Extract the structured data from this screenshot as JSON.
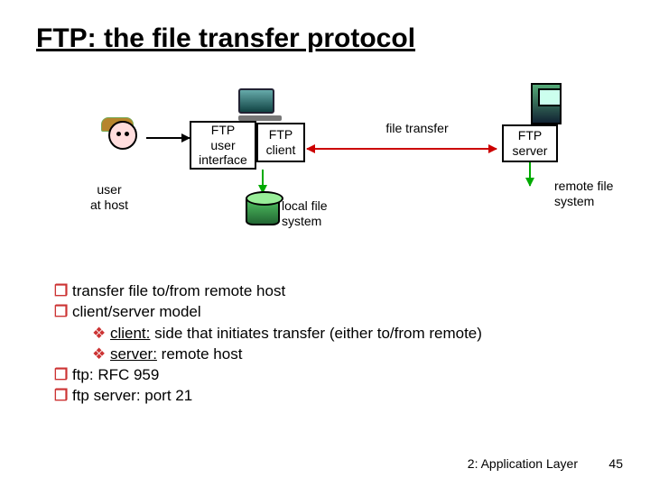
{
  "title": "FTP: the file transfer protocol",
  "diagram": {
    "user_at_host": "user\nat host",
    "ftp_ui": "FTP\nuser\ninterface",
    "ftp_client": "FTP\nclient",
    "ftp_server": "FTP\nserver",
    "file_transfer": "file transfer",
    "local_fs": "local file\nsystem",
    "remote_fs": "remote file\nsystem"
  },
  "bullets": {
    "b1": "transfer file to/from remote host",
    "b2": "client/server model",
    "b2a_prefix": "client:",
    "b2a_rest": " side that initiates transfer (either to/from remote)",
    "b2b_prefix": "server:",
    "b2b_rest": " remote host",
    "b3": "ftp: RFC 959",
    "b4": "ftp server: port 21"
  },
  "footer": {
    "chapter": "2: Application Layer",
    "page": "45"
  }
}
